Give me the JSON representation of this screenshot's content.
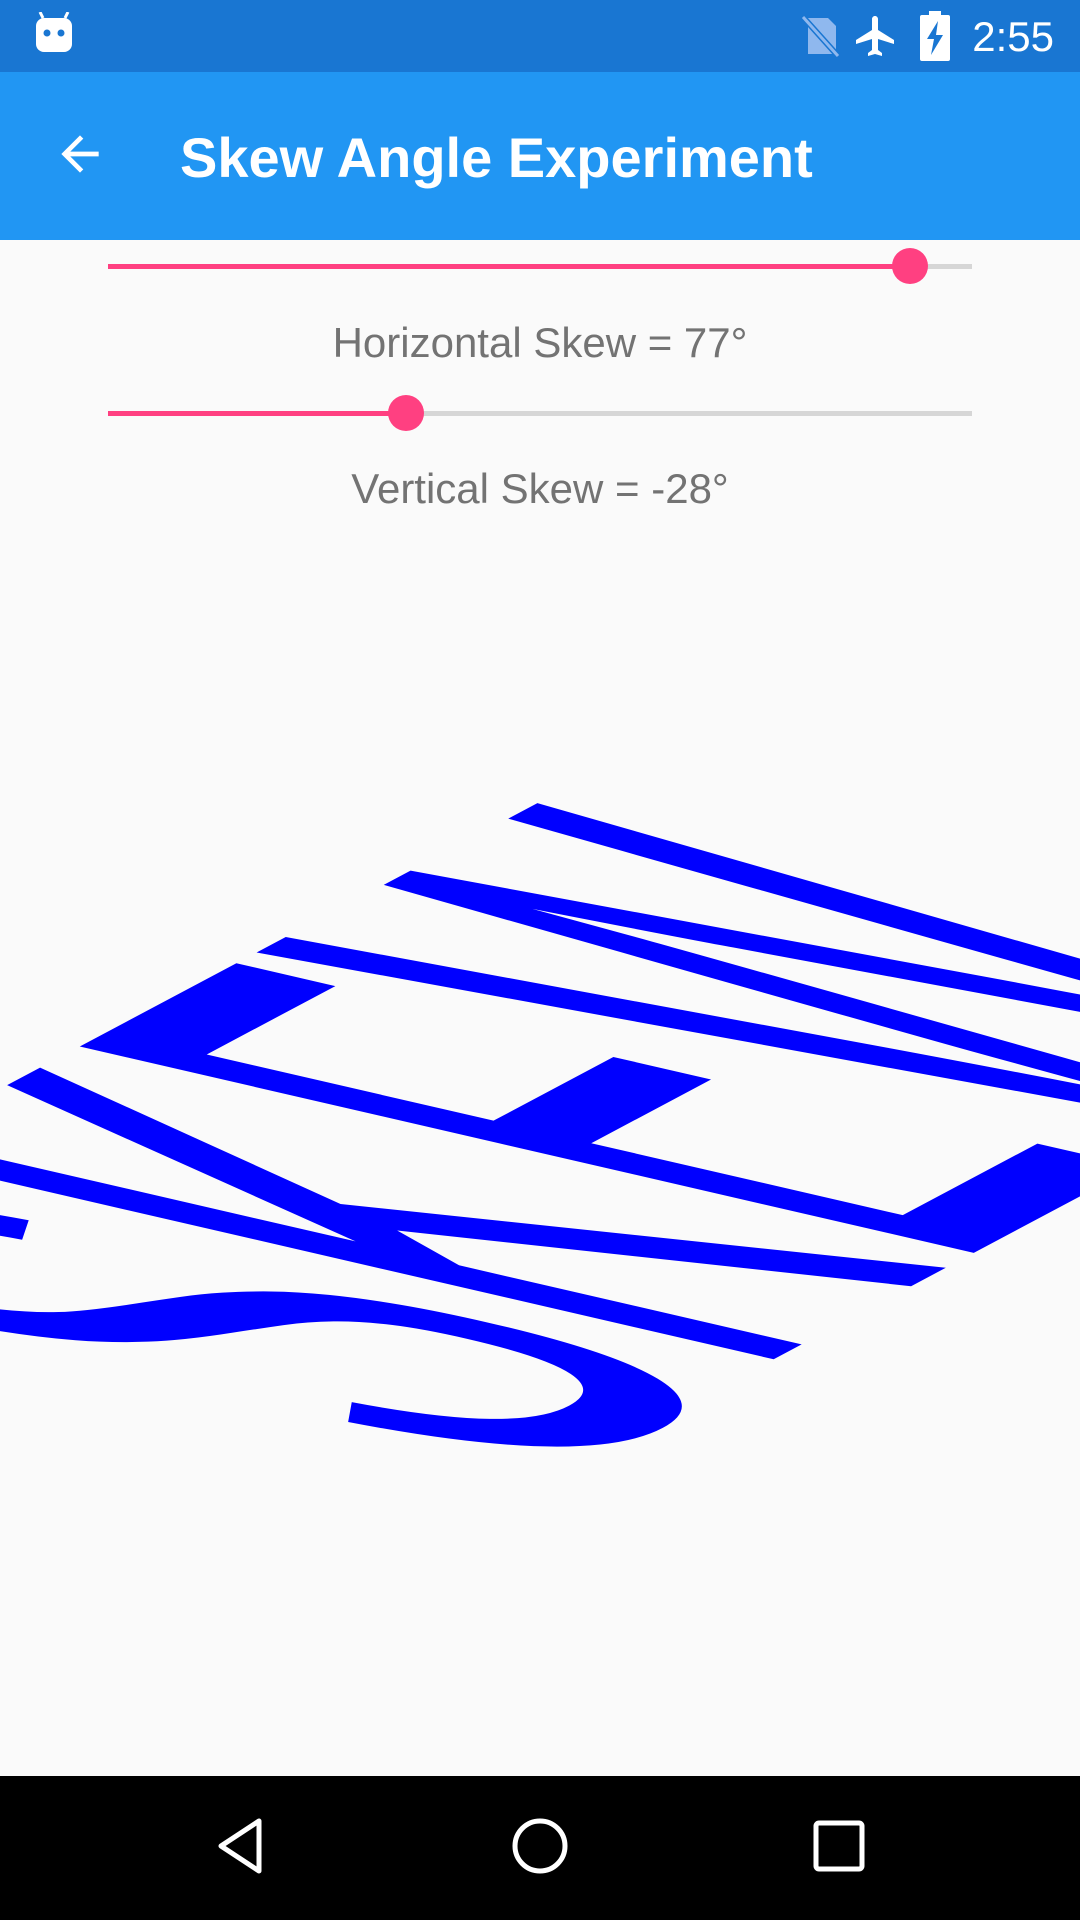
{
  "status_bar": {
    "time": "2:55",
    "icons": [
      "android-bot-icon",
      "no-sim-icon",
      "airplane-mode-icon",
      "battery-charging-icon"
    ]
  },
  "app_bar": {
    "title": "Skew Angle Experiment",
    "back_icon": "arrow-back-icon",
    "color": "#2196F3"
  },
  "horizontal_slider": {
    "value": 77,
    "min": -90,
    "max": 90,
    "label": "Horizontal Skew = 77°"
  },
  "vertical_slider": {
    "value": -28,
    "min": -90,
    "max": 90,
    "label": "Vertical Skew = -28°"
  },
  "skew_text": {
    "text": "SKEW",
    "color": "#0000FF"
  },
  "accent_color": "#FF4081",
  "nav_bar": {
    "buttons": [
      "back-triangle-icon",
      "home-circle-icon",
      "recents-square-icon"
    ]
  }
}
